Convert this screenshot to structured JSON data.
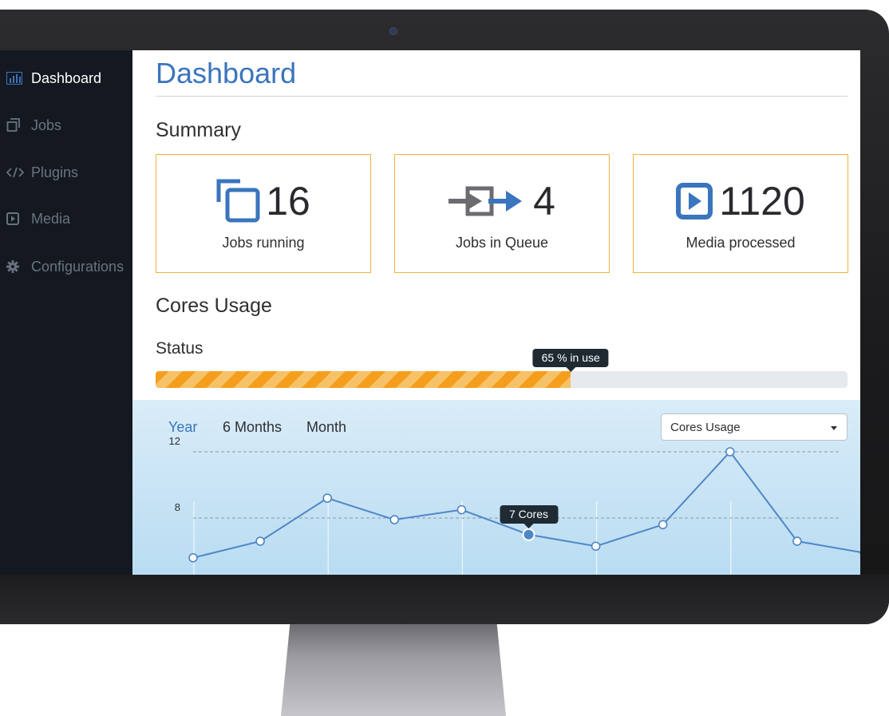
{
  "sidebar": {
    "items": [
      {
        "label": "Dashboard",
        "icon": "bar-chart-icon",
        "active": true
      },
      {
        "label": "Jobs",
        "icon": "copy-icon",
        "active": false
      },
      {
        "label": "Plugins",
        "icon": "code-icon",
        "active": false
      },
      {
        "label": "Media",
        "icon": "play-square-icon",
        "active": false
      },
      {
        "label": "Configurations",
        "icon": "gear-icon",
        "active": false
      }
    ]
  },
  "header": {
    "title": "Dashboard"
  },
  "summary": {
    "heading": "Summary",
    "cards": [
      {
        "value": "16",
        "label": "Jobs running",
        "icon": "copy-icon"
      },
      {
        "value": "4",
        "label": "Jobs in Queue",
        "icon": "queue-arrow-icon"
      },
      {
        "value": "1120",
        "label": "Media processed",
        "icon": "play-square-icon"
      }
    ]
  },
  "cores": {
    "heading": "Cores Usage",
    "status_label": "Status",
    "progress_fraction": 0.6,
    "progress_tooltip": "65 % in use"
  },
  "chart_panel": {
    "tabs": [
      {
        "label": "Year",
        "active": true
      },
      {
        "label": "6 Months",
        "active": false
      },
      {
        "label": "Month",
        "active": false
      }
    ],
    "select_value": "Cores Usage",
    "tooltip": "7 Cores"
  },
  "colors": {
    "accent": "#3a75bd",
    "card_border": "#f0b43a",
    "progress_stripe_a": "#f59e1d",
    "progress_stripe_b": "#f7c267",
    "sidebar_bg": "#141820",
    "line": "#4f86c6"
  },
  "chart_data": {
    "type": "line",
    "x": [
      1,
      2,
      3,
      4,
      5,
      6,
      7,
      8,
      9,
      10,
      11
    ],
    "values": [
      5.6,
      6.6,
      9.2,
      7.9,
      8.5,
      7.0,
      6.3,
      7.6,
      12.0,
      6.6,
      5.9
    ],
    "highlight_index": 5,
    "ylim": [
      4,
      12
    ],
    "y_ticks": [
      "12",
      "8"
    ],
    "grid": true
  }
}
